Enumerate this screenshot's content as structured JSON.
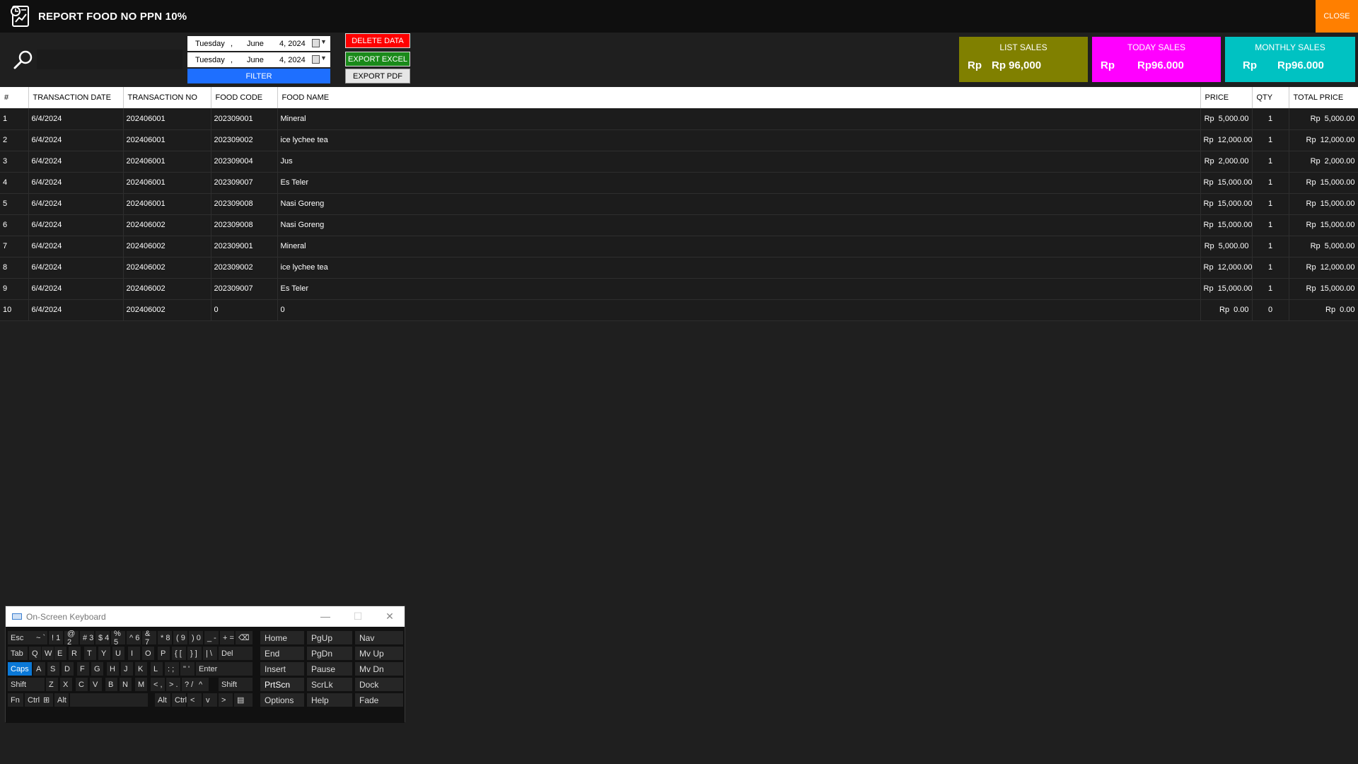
{
  "window": {
    "title": "REPORT FOOD NO  PPN 10%",
    "close_label": "CLOSE"
  },
  "toolbar": {
    "search_placeholder": "",
    "date_from": {
      "day": "Tuesday",
      "comma": ",",
      "month": "June",
      "date": "4, 2024"
    },
    "date_to": {
      "day": "Tuesday",
      "comma": ",",
      "month": "June",
      "date": "4, 2024"
    },
    "filter_label": "FILTER",
    "delete_label": "DELETE DATA",
    "export_excel_label": "EXPORT EXCEL",
    "export_pdf_label": "EXPORT PDF"
  },
  "cards": {
    "list": {
      "title": "LIST SALES",
      "rp": "Rp",
      "value": "Rp 96,000",
      "color": "#808000"
    },
    "today": {
      "title": "TODAY SALES",
      "rp": "Rp",
      "value": "Rp96.000",
      "color": "#ff00ff"
    },
    "monthly": {
      "title": "MONTHLY SALES",
      "rp": "Rp",
      "value": "Rp96.000",
      "color": "#00c2c2"
    }
  },
  "table": {
    "columns": [
      "#",
      "TRANSACTION DATE",
      "TRANSACTION NO",
      "FOOD CODE",
      "FOOD NAME",
      "PRICE",
      "QTY",
      "TOTAL PRICE"
    ],
    "rows": [
      {
        "no": "1",
        "date": "6/4/2024",
        "trx": "202406001",
        "code": "202309001",
        "name": "Mineral",
        "price_rp": "Rp",
        "price": "5,000.00",
        "qty": "1",
        "total_rp": "Rp",
        "total": "5,000.00"
      },
      {
        "no": "2",
        "date": "6/4/2024",
        "trx": "202406001",
        "code": "202309002",
        "name": "ice lychee tea",
        "price_rp": "Rp",
        "price": "12,000.00",
        "qty": "1",
        "total_rp": "Rp",
        "total": "12,000.00"
      },
      {
        "no": "3",
        "date": "6/4/2024",
        "trx": "202406001",
        "code": "202309004",
        "name": "Jus",
        "price_rp": "Rp",
        "price": "2,000.00",
        "qty": "1",
        "total_rp": "Rp",
        "total": "2,000.00"
      },
      {
        "no": "4",
        "date": "6/4/2024",
        "trx": "202406001",
        "code": "202309007",
        "name": "Es Teler",
        "price_rp": "Rp",
        "price": "15,000.00",
        "qty": "1",
        "total_rp": "Rp",
        "total": "15,000.00"
      },
      {
        "no": "5",
        "date": "6/4/2024",
        "trx": "202406001",
        "code": "202309008",
        "name": "Nasi Goreng",
        "price_rp": "Rp",
        "price": "15,000.00",
        "qty": "1",
        "total_rp": "Rp",
        "total": "15,000.00"
      },
      {
        "no": "6",
        "date": "6/4/2024",
        "trx": "202406002",
        "code": "202309008",
        "name": "Nasi Goreng",
        "price_rp": "Rp",
        "price": "15,000.00",
        "qty": "1",
        "total_rp": "Rp",
        "total": "15,000.00"
      },
      {
        "no": "7",
        "date": "6/4/2024",
        "trx": "202406002",
        "code": "202309001",
        "name": "Mineral",
        "price_rp": "Rp",
        "price": "5,000.00",
        "qty": "1",
        "total_rp": "Rp",
        "total": "5,000.00"
      },
      {
        "no": "8",
        "date": "6/4/2024",
        "trx": "202406002",
        "code": "202309002",
        "name": "ice lychee tea",
        "price_rp": "Rp",
        "price": "12,000.00",
        "qty": "1",
        "total_rp": "Rp",
        "total": "12,000.00"
      },
      {
        "no": "9",
        "date": "6/4/2024",
        "trx": "202406002",
        "code": "202309007",
        "name": "Es Teler",
        "price_rp": "Rp",
        "price": "15,000.00",
        "qty": "1",
        "total_rp": "Rp",
        "total": "15,000.00"
      },
      {
        "no": "10",
        "date": "6/4/2024",
        "trx": "202406002",
        "code": "0",
        "name": "0",
        "price_rp": "Rp",
        "price": "0.00",
        "qty": "0",
        "total_rp": "Rp",
        "total": "0.00"
      }
    ]
  },
  "osk": {
    "title": "On-Screen Keyboard",
    "rows": [
      [
        "Esc",
        "~ `",
        "! 1",
        "@ 2",
        "# 3",
        "$ 4",
        "% 5",
        "^ 6",
        "& 7",
        "* 8",
        "( 9",
        ") 0",
        "_ -",
        "+ =",
        "⌫"
      ],
      [
        "Tab",
        "Q",
        "W",
        "E",
        "R",
        "T",
        "Y",
        "U",
        "I",
        "O",
        "P",
        "{ [",
        "} ]",
        "| \\",
        "Del"
      ],
      [
        "Caps",
        "A",
        "S",
        "D",
        "F",
        "G",
        "H",
        "J",
        "K",
        "L",
        ": ;",
        "\" '",
        "Enter"
      ],
      [
        "Shift",
        "Z",
        "X",
        "C",
        "V",
        "B",
        "N",
        "M",
        "< ,",
        "> .",
        "? /",
        "^",
        "Shift"
      ],
      [
        "Fn",
        "Ctrl",
        "⊞",
        "Alt",
        "",
        "Alt",
        "Ctrl",
        "<",
        "v",
        ">",
        "▤"
      ]
    ],
    "side": [
      [
        "Home",
        "PgUp",
        "Nav"
      ],
      [
        "End",
        "PgDn",
        "Mv Up"
      ],
      [
        "Insert",
        "Pause",
        "Mv Dn"
      ],
      [
        "PrtScn",
        "ScrLk",
        "Dock"
      ],
      [
        "Options",
        "Help",
        "Fade"
      ]
    ]
  }
}
